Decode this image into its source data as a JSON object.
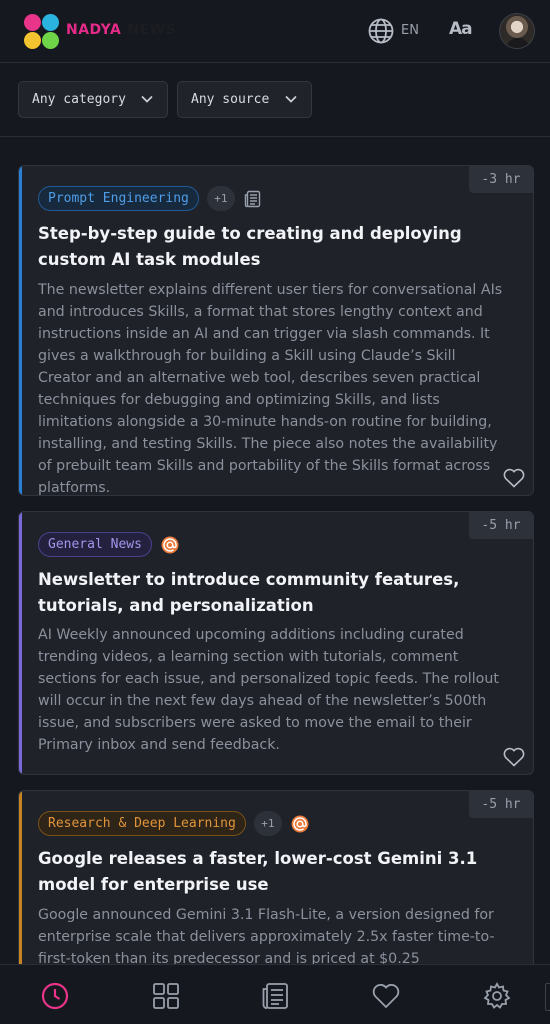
{
  "header": {
    "brand_primary": "NADYA",
    "brand_secondary": ".NEWS",
    "language": "EN",
    "text_size_label": "Aa",
    "logo_colors": [
      "#e8358a",
      "#2bb3e0",
      "#f4c430",
      "#6fd448"
    ],
    "icons": [
      "globe-icon",
      "text-size-icon",
      "avatar"
    ]
  },
  "filters": {
    "category": "Any category",
    "source": "Any source"
  },
  "cards": [
    {
      "time": "-3 hr",
      "tag": "Prompt Engineering",
      "tag_more": "+1",
      "source_icon": "newspaper-icon",
      "accent": "#2a7fd4",
      "title": "Step-by-step guide to creating and deploying custom AI task modules",
      "summary": "The newsletter explains different user tiers for conversational AIs and introduces Skills, a format that stores lengthy context and instructions inside an AI and can trigger via slash commands. It gives a walkthrough for building a Skill using Claude’s Skill Creator and an alternative web tool, describes seven practical techniques for debugging and optimizing Skills, and lists limitations alongside a 30-minute hands-on routine for building, installing, and testing Skills. The piece also notes the availability of prebuilt team Skills and portability of the Skills format across platforms."
    },
    {
      "time": "-5 hr",
      "tag": "General News",
      "tag_more": "",
      "source_icon": "email-at-icon",
      "accent": "#7b68d8",
      "title": "Newsletter to introduce community features, tutorials, and personalization",
      "summary": "AI Weekly announced upcoming additions including curated trending videos, a learning section with tutorials, comment sections for each issue, and personalized topic feeds. The rollout will occur in the next few days ahead of the newsletter’s 500th issue, and subscribers were asked to move the email to their Primary inbox and send feedback."
    },
    {
      "time": "-5 hr",
      "tag": "Research & Deep Learning",
      "tag_more": "+1",
      "source_icon": "email-at-icon",
      "accent": "#c88420",
      "title": "Google releases a faster, lower-cost Gemini 3.1 model for enterprise use",
      "summary": "Google announced Gemini 3.1 Flash-Lite, a version designed for enterprise scale that delivers approximately 2.5x faster time-to-first-token than its predecessor and is priced at $0.25"
    }
  ],
  "bottom_nav": [
    "clock-icon",
    "grid-icon",
    "newspaper-icon",
    "heart-icon",
    "gear-icon"
  ],
  "colors": {
    "active_nav": "#e8358a",
    "background": "#15181e",
    "card": "#1f2229"
  }
}
